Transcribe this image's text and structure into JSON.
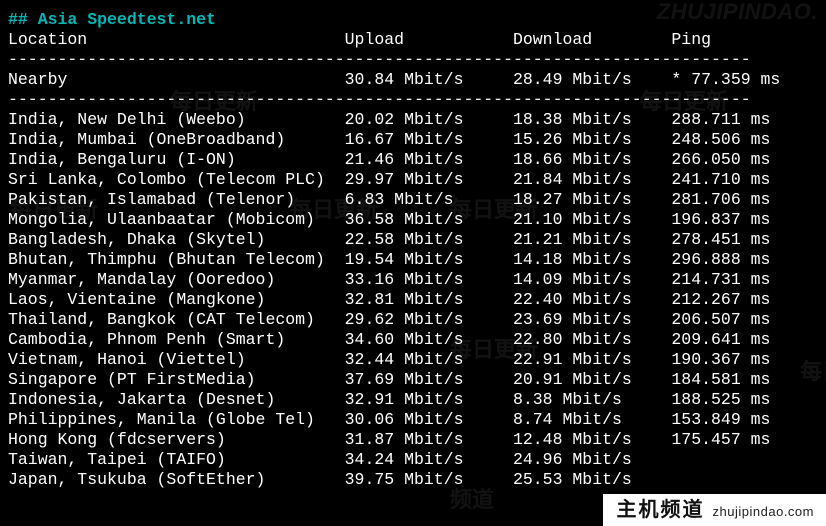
{
  "title": "## Asia Speedtest.net",
  "columns": {
    "location": "Location",
    "upload": "Upload",
    "download": "Download",
    "ping": "Ping"
  },
  "separator": "---------------------------------------------------------------------------",
  "nearby": {
    "location": "Nearby",
    "upload": "30.84 Mbit/s",
    "download": "28.49 Mbit/s",
    "ping": "* 77.359 ms"
  },
  "rows": [
    {
      "location": "India, New Delhi (Weebo)",
      "upload": "20.02 Mbit/s",
      "download": "18.38 Mbit/s",
      "ping": "288.711 ms"
    },
    {
      "location": "India, Mumbai (OneBroadband)",
      "upload": "16.67 Mbit/s",
      "download": "15.26 Mbit/s",
      "ping": "248.506 ms"
    },
    {
      "location": "India, Bengaluru (I-ON)",
      "upload": "21.46 Mbit/s",
      "download": "18.66 Mbit/s",
      "ping": "266.050 ms"
    },
    {
      "location": "Sri Lanka, Colombo (Telecom PLC)",
      "upload": "29.97 Mbit/s",
      "download": "21.84 Mbit/s",
      "ping": "241.710 ms"
    },
    {
      "location": "Pakistan, Islamabad (Telenor)",
      "upload": "6.83 Mbit/s",
      "download": "18.27 Mbit/s",
      "ping": "281.706 ms"
    },
    {
      "location": "Mongolia, Ulaanbaatar (Mobicom)",
      "upload": "36.58 Mbit/s",
      "download": "21.10 Mbit/s",
      "ping": "196.837 ms"
    },
    {
      "location": "Bangladesh, Dhaka (Skytel)",
      "upload": "22.58 Mbit/s",
      "download": "21.21 Mbit/s",
      "ping": "278.451 ms"
    },
    {
      "location": "Bhutan, Thimphu (Bhutan Telecom)",
      "upload": "19.54 Mbit/s",
      "download": "14.18 Mbit/s",
      "ping": "296.888 ms"
    },
    {
      "location": "Myanmar, Mandalay (Ooredoo)",
      "upload": "33.16 Mbit/s",
      "download": "14.09 Mbit/s",
      "ping": "214.731 ms"
    },
    {
      "location": "Laos, Vientaine (Mangkone)",
      "upload": "32.81 Mbit/s",
      "download": "22.40 Mbit/s",
      "ping": "212.267 ms"
    },
    {
      "location": "Thailand, Bangkok (CAT Telecom)",
      "upload": "29.62 Mbit/s",
      "download": "23.69 Mbit/s",
      "ping": "206.507 ms"
    },
    {
      "location": "Cambodia, Phnom Penh (Smart)",
      "upload": "34.60 Mbit/s",
      "download": "22.80 Mbit/s",
      "ping": "209.641 ms"
    },
    {
      "location": "Vietnam, Hanoi (Viettel)",
      "upload": "32.44 Mbit/s",
      "download": "22.91 Mbit/s",
      "ping": "190.367 ms"
    },
    {
      "location": "Singapore (PT FirstMedia)",
      "upload": "37.69 Mbit/s",
      "download": "20.91 Mbit/s",
      "ping": "184.581 ms"
    },
    {
      "location": "Indonesia, Jakarta (Desnet)",
      "upload": "32.91 Mbit/s",
      "download": "8.38 Mbit/s",
      "ping": "188.525 ms"
    },
    {
      "location": "Philippines, Manila (Globe Tel)",
      "upload": "30.06 Mbit/s",
      "download": "8.74 Mbit/s",
      "ping": "153.849 ms"
    },
    {
      "location": "Hong Kong (fdcservers)",
      "upload": "31.87 Mbit/s",
      "download": "12.48 Mbit/s",
      "ping": "175.457 ms"
    },
    {
      "location": "Taiwan, Taipei (TAIFO)",
      "upload": "34.24 Mbit/s",
      "download": "24.96 Mbit/s",
      "ping": ""
    },
    {
      "location": "Japan, Tsukuba (SoftEther)",
      "upload": "39.75 Mbit/s",
      "download": "25.53 Mbit/s",
      "ping": ""
    }
  ],
  "watermarks": {
    "top_right": "ZHUJIPINDAO.",
    "fade_cn_a": "每日更新",
    "fade_cn_b": "频道"
  },
  "brand": {
    "cn": "主机频道",
    "en": "zhujipindao.com"
  },
  "col_widths": {
    "loc": 34,
    "up": 17,
    "down": 16
  }
}
